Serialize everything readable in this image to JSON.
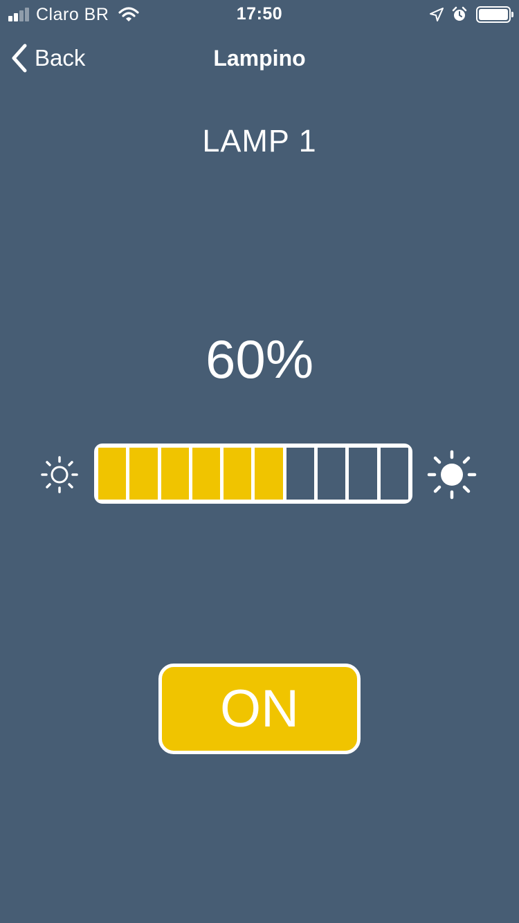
{
  "status_bar": {
    "carrier": "Claro BR",
    "time": "17:50",
    "signal_bars_active": 2,
    "signal_bars_total": 4,
    "battery_level": 1.0
  },
  "nav": {
    "back_label": "Back",
    "title": "Lampino"
  },
  "lamp": {
    "name": "LAMP 1",
    "brightness_text": "60%",
    "brightness_percent": 60,
    "segments_total": 10,
    "power_label": "ON"
  },
  "icons": {
    "back": "chevron-left-icon",
    "dim": "sun-outline-icon",
    "bright": "sun-filled-icon",
    "location": "location-arrow-icon",
    "alarm": "alarm-clock-icon",
    "wifi": "wifi-icon",
    "battery": "battery-icon"
  },
  "colors": {
    "background": "#475d74",
    "accent": "#f0c400",
    "foreground": "#ffffff"
  }
}
